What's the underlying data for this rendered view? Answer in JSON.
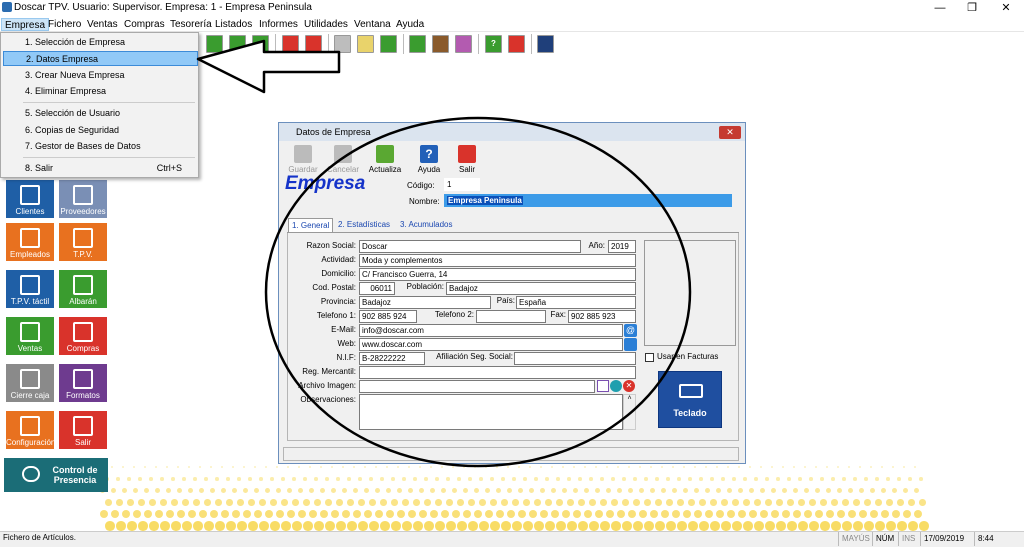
{
  "window": {
    "title": "Doscar TPV. Usuario: Supervisor. Empresa: 1 - Empresa Peninsula",
    "minimize": "—",
    "maximize": "❐",
    "close": "✕"
  },
  "menu": [
    "Empresa",
    "Fichero",
    "Ventas",
    "Compras",
    "Tesorería",
    "Listados",
    "Informes",
    "Utilidades",
    "Ventana",
    "Ayuda"
  ],
  "dropdown": {
    "items": [
      "1. Selección de Empresa",
      "2. Datos Empresa",
      "3. Crear Nueva Empresa",
      "4. Eliminar Empresa",
      "5. Selección de Usuario",
      "6. Copias de Seguridad",
      "7. Gestor de Bases de Datos",
      "8. Salir"
    ],
    "salir_shortcut": "Ctrl+S"
  },
  "tiles": [
    "Clientes",
    "Proveedores",
    "Empleados",
    "T.P.V.",
    "T.P.V. táctil",
    "Albarán",
    "Ventas",
    "Compras",
    "Cierre caja",
    "Formatos",
    "Configuración",
    "Salir"
  ],
  "presence_tile": "Control de Presencia",
  "dialog": {
    "title": "Datos de Empresa",
    "toolbar": [
      "Guardar",
      "Cancelar",
      "Actualiza",
      "Ayuda",
      "Salir"
    ],
    "heading": "Empresa",
    "codigo_label": "Código:",
    "codigo": "1",
    "nombre_label": "Nombre:",
    "nombre": "Empresa Peninsula",
    "tabs": [
      "1. General",
      "2. Estadísticas",
      "3. Acumulados"
    ],
    "labels": {
      "razon": "Razon Social:",
      "ano": "Año:",
      "actividad": "Actividad:",
      "domicilio": "Domicilio:",
      "cp": "Cod. Postal:",
      "poblacion": "Población:",
      "provincia": "Provincia:",
      "pais": "País:",
      "tel1": "Telefono 1:",
      "tel2": "Telefono 2:",
      "fax": "Fax:",
      "email": "E-Mail:",
      "web": "Web:",
      "nif": "N.I.F:",
      "afiliacion": "Afiliación Seg. Social:",
      "mercantil": "Reg. Mercantil:",
      "imagen": "Archivo Imagen:",
      "observaciones": "Observaciones:"
    },
    "values": {
      "razon": "Doscar",
      "ano": "2019",
      "actividad": "Moda y complementos",
      "domicilio": "C/ Francisco Guerra, 14",
      "cp": "06011",
      "poblacion": "Badajoz",
      "provincia": "Badajoz",
      "pais": "España",
      "tel1": "902 885 924",
      "tel2": "",
      "fax": "902 885 923",
      "email": "info@doscar.com",
      "web": "www.doscar.com",
      "nif": "B-28222222",
      "afiliacion": "",
      "mercantil": "",
      "imagen": "",
      "observaciones": ""
    },
    "usar_facturas": "Usar en Facturas",
    "teclado": "Teclado"
  },
  "status": {
    "text": "Fichero de Artículos.",
    "mayus": "MAYÚS",
    "num": "NÚM",
    "ins": "INS",
    "date": "17/09/2019",
    "time": "8:44"
  },
  "colors": {
    "accent_blue": "#1f5fa6",
    "heading_blue": "#1533c9",
    "selection": "#3c9be8"
  }
}
